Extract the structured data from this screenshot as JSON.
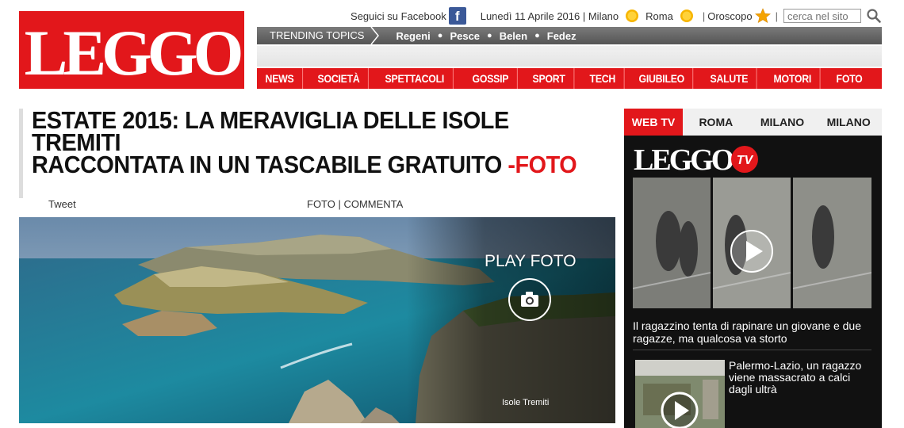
{
  "header": {
    "logo_text": "LEGGO",
    "follow_facebook": "Seguici su Facebook",
    "facebook_glyph": "f",
    "date_city": "Lunedì 11 Aprile 2016 | Milano",
    "roma_label": "Roma",
    "oroscopo_label": "Oroscopo",
    "search_placeholder": "cerca nel sito",
    "icons": [
      "facebook-icon",
      "sun-icon",
      "star-icon",
      "search-icon"
    ]
  },
  "trending": {
    "label": "TRENDING TOPICS",
    "topics": [
      "Regeni",
      "Pesce",
      "Belen",
      "Fedez"
    ]
  },
  "nav": {
    "items": [
      "NEWS",
      "SOCIETÀ",
      "SPETTACOLI",
      "GOSSIP",
      "SPORT",
      "TECH",
      "GIUBILEO",
      "SALUTE",
      "MOTORI",
      "FOTO"
    ]
  },
  "article": {
    "headline_line1": "ESTATE 2015: LA MERAVIGLIA DELLE ISOLE",
    "headline_line2": "TREMITI",
    "headline_line3": "RACCONTATA IN UN TASCABILE GRATUITO",
    "headline_suffix": "-FOTO",
    "tweet_label": "Tweet",
    "foto_commenta": "FOTO | COMMENTA",
    "play_foto": "PLAY FOTO",
    "image_caption": "Isole Tremiti"
  },
  "sidebar": {
    "tabs": [
      "WEB TV",
      "ROMA",
      "MILANO",
      "MILANO"
    ],
    "tv_logo_text": "LEGGO",
    "tv_badge": "TV",
    "video1_title": "Il ragazzino tenta di rapinare un giovane e due ragazze, ma qualcosa va storto",
    "video2_title": "Palermo-Lazio, un ragazzo viene massacrato a calci dagli ultrà"
  },
  "colors": {
    "brand_red": "#e2171b",
    "dark_panel": "#111111",
    "trending_gray": "#666666"
  }
}
